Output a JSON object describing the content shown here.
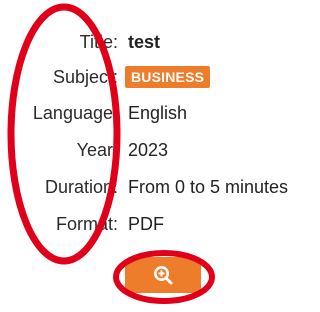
{
  "details": {
    "title_label": "Title:",
    "title_value": "test",
    "subject_label": "Subject:",
    "subject_value": "BUSINESS",
    "language_label": "Language:",
    "language_value": "English",
    "year_label": "Year:",
    "year_value": "2023",
    "duration_label": "Duration:",
    "duration_value": "From 0 to 5 minutes",
    "format_label": "Format:",
    "format_value": "PDF"
  },
  "action": {
    "icon": "zoom-in-icon"
  },
  "colors": {
    "accent": "#ee7d2b",
    "annotation": "#e0001a"
  }
}
